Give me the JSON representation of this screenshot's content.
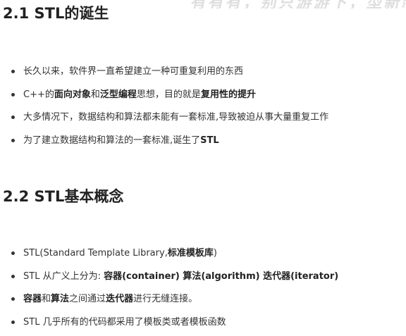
{
  "watermark": {
    "text": "有有有，别只游游下，型新新"
  },
  "section1": {
    "heading": "2.1 STL的诞生",
    "items": [
      {
        "t1": "长久以来，软件界一直希望建立一种可重复利用的东西"
      },
      {
        "t1": "C++的",
        "b1": "面向对象",
        "t2": "和",
        "b2": "泛型编程",
        "t3": "思想，目的就是",
        "b3": "复用性的提升"
      },
      {
        "t1": "大多情况下，数据结构和算法都未能有一套标准,导致被迫从事大量重复工作"
      },
      {
        "t1": "为了建立数据结构和算法的一套标准,诞生了",
        "b1": "STL"
      }
    ]
  },
  "section2": {
    "heading": "2.2 STL基本概念",
    "items": [
      {
        "t1": "STL(Standard Template Library,",
        "b1": "标准模板库",
        "t2": ")"
      },
      {
        "t1": "STL 从广义上分为: ",
        "b1": "容器(container) 算法(algorithm) 迭代器(iterator)"
      },
      {
        "b1": "容器",
        "t1": "和",
        "b2": "算法",
        "t2": "之间通过",
        "b3": "迭代器",
        "t3": "进行无缝连接。"
      },
      {
        "t1": "STL 几乎所有的代码都采用了模板类或者模板函数"
      }
    ]
  }
}
